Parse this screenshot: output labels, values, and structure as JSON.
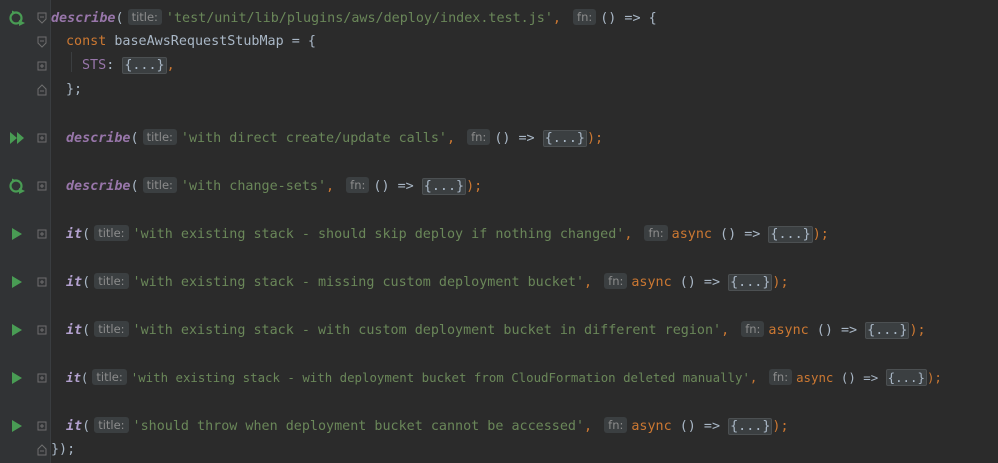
{
  "hints": {
    "title": "title:",
    "fn": "fn:"
  },
  "lines": [
    {
      "call": "describe",
      "title": "'test/unit/lib/plugins/aws/deploy/index.test.js'",
      "sep": ",",
      "fn_text": "() => {",
      "tail": "",
      "icon": "run-rerun-icon"
    },
    {
      "const_kw": "const",
      "name": "baseAwsRequestStubMap",
      "rest": " = {"
    },
    {
      "prop": "STS",
      "colon": ": ",
      "chip": "{...}",
      "comma": ","
    },
    {
      "close": "};"
    },
    {
      "call": "describe",
      "title": "'with direct create/update calls'",
      "sep": ",",
      "fn_text": "() =>",
      "chip": "{...}",
      "tail": ");",
      "icon": "run-all-icon"
    },
    {
      "call": "describe",
      "title": "'with change-sets'",
      "sep": ",",
      "fn_text": "() =>",
      "chip": "{...}",
      "tail": ");",
      "icon": "run-rerun-icon"
    },
    {
      "call": "it",
      "title": "'with existing stack - should skip deploy if nothing changed'",
      "sep": ",",
      "async": "async",
      "fn_text": "() =>",
      "chip": "{...}",
      "tail": ");",
      "icon": "run-icon"
    },
    {
      "call": "it",
      "title": "'with existing stack - missing custom deployment bucket'",
      "sep": ",",
      "async": "async",
      "fn_text": "() =>",
      "chip": "{...}",
      "tail": ");",
      "icon": "run-icon"
    },
    {
      "call": "it",
      "title": "'with existing stack - with custom deployment bucket in different region'",
      "sep": ",",
      "async": "async",
      "fn_text": "() =>",
      "chip": "{...}",
      "tail": ");",
      "icon": "run-icon"
    },
    {
      "call": "it",
      "title": "'with existing stack - with deployment bucket from CloudFormation deleted manually'",
      "sep": ",",
      "async": "async",
      "fn_text": "() =>",
      "chip": "{...}",
      "tail": ");",
      "icon": "run-icon"
    },
    {
      "call": "it",
      "title": "'should throw when deployment bucket cannot be accessed'",
      "sep": ",",
      "async": "async",
      "fn_text": "() =>",
      "chip": "{...}",
      "tail": ");",
      "icon": "run-icon"
    },
    {
      "close": "});"
    }
  ],
  "colors": {
    "background": "#2b2b2b",
    "run_green": "#499c54",
    "string": "#6a8759",
    "keyword": "#cc7832",
    "call": "#9876aa"
  }
}
